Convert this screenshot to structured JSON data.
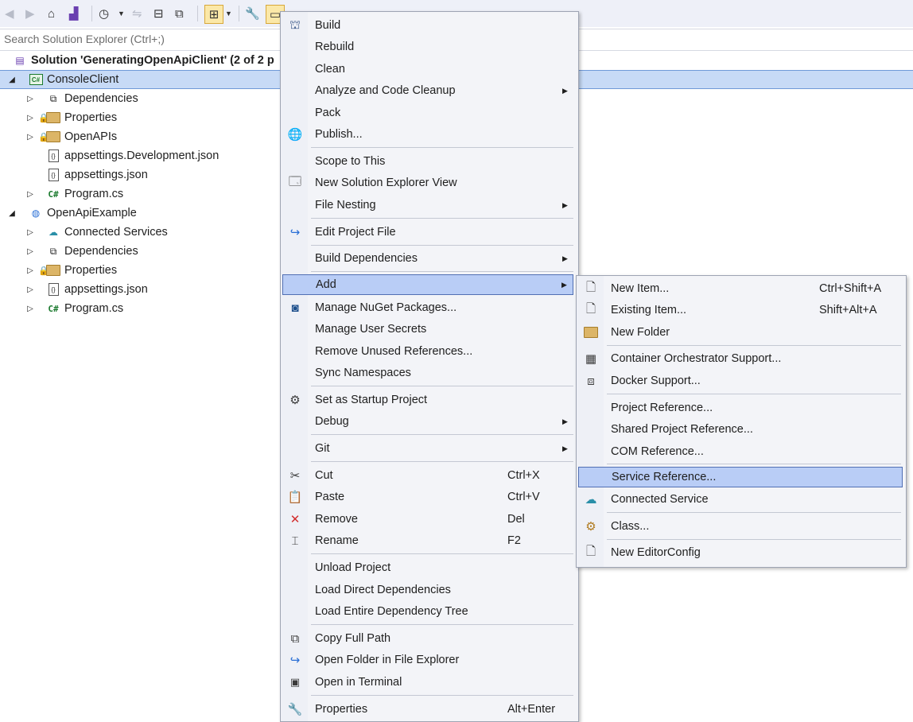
{
  "explorer": {
    "search_placeholder": "Search Solution Explorer (Ctrl+;)",
    "solution_label": "Solution 'GeneratingOpenApiClient' (2 of 2 p",
    "tree": [
      {
        "label": "ConsoleClient",
        "icon": "csharp-project-icon"
      },
      {
        "label": "Dependencies",
        "icon": "dependencies-icon"
      },
      {
        "label": "Properties",
        "icon": "properties-folder-icon"
      },
      {
        "label": "OpenAPIs",
        "icon": "folder-icon"
      },
      {
        "label": "appsettings.Development.json",
        "icon": "json-file-icon"
      },
      {
        "label": "appsettings.json",
        "icon": "json-file-icon"
      },
      {
        "label": "Program.cs",
        "icon": "csharp-file-icon"
      },
      {
        "label": "OpenApiExample",
        "icon": "web-project-icon"
      },
      {
        "label": "Connected Services",
        "icon": "connected-services-icon"
      },
      {
        "label": "Dependencies",
        "icon": "dependencies-icon"
      },
      {
        "label": "Properties",
        "icon": "properties-folder-icon"
      },
      {
        "label": "appsettings.json",
        "icon": "json-file-icon"
      },
      {
        "label": "Program.cs",
        "icon": "csharp-file-icon"
      }
    ],
    "csharp_glyph": "C#"
  },
  "context_menu": {
    "items": [
      {
        "label": "Build",
        "icon": "build-icon"
      },
      {
        "label": "Rebuild"
      },
      {
        "label": "Clean"
      },
      {
        "label": "Analyze and Code Cleanup",
        "submenu": true
      },
      {
        "label": "Pack"
      },
      {
        "label": "Publish...",
        "icon": "globe-publish-icon"
      },
      {
        "label": "Scope to This"
      },
      {
        "label": "New Solution Explorer View",
        "icon": "new-view-icon"
      },
      {
        "label": "File Nesting",
        "submenu": true
      },
      {
        "label": "Edit Project File",
        "icon": "edit-redo-icon"
      },
      {
        "label": "Build Dependencies",
        "submenu": true
      },
      {
        "label": "Add",
        "submenu": true,
        "highlighted": true
      },
      {
        "label": "Manage NuGet Packages...",
        "icon": "nuget-icon"
      },
      {
        "label": "Manage User Secrets"
      },
      {
        "label": "Remove Unused References..."
      },
      {
        "label": "Sync Namespaces"
      },
      {
        "label": "Set as Startup Project",
        "icon": "gear-icon"
      },
      {
        "label": "Debug",
        "submenu": true
      },
      {
        "label": "Git",
        "submenu": true
      },
      {
        "label": "Cut",
        "icon": "scissors-icon",
        "shortcut": "Ctrl+X"
      },
      {
        "label": "Paste",
        "icon": "paste-icon",
        "shortcut": "Ctrl+V"
      },
      {
        "label": "Remove",
        "icon": "remove-x-icon",
        "shortcut": "Del"
      },
      {
        "label": "Rename",
        "icon": "rename-icon",
        "shortcut": "F2"
      },
      {
        "label": "Unload Project"
      },
      {
        "label": "Load Direct Dependencies"
      },
      {
        "label": "Load Entire Dependency Tree"
      },
      {
        "label": "Copy Full Path",
        "icon": "copy-icon"
      },
      {
        "label": "Open Folder in File Explorer",
        "icon": "folder-open-icon"
      },
      {
        "label": "Open in Terminal",
        "icon": "terminal-icon"
      },
      {
        "label": "Properties",
        "icon": "wrench-icon",
        "shortcut": "Alt+Enter"
      }
    ]
  },
  "add_submenu": {
    "items": [
      {
        "label": "New Item...",
        "icon": "new-item-icon",
        "shortcut": "Ctrl+Shift+A"
      },
      {
        "label": "Existing Item...",
        "icon": "existing-item-icon",
        "shortcut": "Shift+Alt+A"
      },
      {
        "label": "New Folder",
        "icon": "new-folder-icon"
      },
      {
        "label": "Container Orchestrator Support...",
        "icon": "container-icon"
      },
      {
        "label": "Docker Support...",
        "icon": "docker-icon"
      },
      {
        "label": "Project Reference..."
      },
      {
        "label": "Shared Project Reference..."
      },
      {
        "label": "COM Reference..."
      },
      {
        "label": "Service Reference...",
        "highlighted": true
      },
      {
        "label": "Connected Service",
        "icon": "connected-service-icon"
      },
      {
        "label": "Class...",
        "icon": "class-icon"
      },
      {
        "label": "New EditorConfig",
        "icon": "editorconfig-icon"
      }
    ]
  }
}
